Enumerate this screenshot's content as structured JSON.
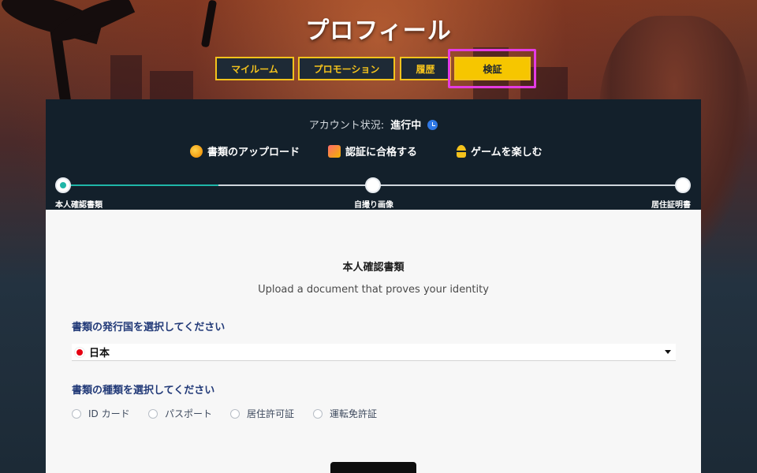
{
  "header": {
    "title": "プロフィール"
  },
  "tabs": [
    {
      "label": "マイルーム"
    },
    {
      "label": "プロモーション"
    },
    {
      "label": "履歴"
    },
    {
      "label": "検証"
    }
  ],
  "account": {
    "status_label": "アカウント状況:",
    "status_value": "進行中"
  },
  "legend": [
    {
      "label": "書類のアップロード",
      "icon": "upload-icon"
    },
    {
      "label": "認証に合格する",
      "icon": "certificate-icon"
    },
    {
      "label": "ゲームを楽しむ",
      "icon": "user-icon"
    }
  ],
  "steps": [
    {
      "label": "本人確認書類"
    },
    {
      "label": "自撮り画像"
    },
    {
      "label": "居住証明書"
    }
  ],
  "progress": {
    "completed_fraction": 0.25
  },
  "form": {
    "title": "本人確認書類",
    "subtitle": "Upload a document that proves your identity",
    "country_label": "書類の発行国を選択してください",
    "country_value": "日本",
    "doc_type_label": "書類の種類を選択してください",
    "doc_types": [
      "ID カード",
      "パスポート",
      "居住許可証",
      "運転免許証"
    ]
  },
  "colors": {
    "accent": "#f4c21c",
    "highlight": "#e43be3",
    "progress": "#1fb6a8"
  }
}
